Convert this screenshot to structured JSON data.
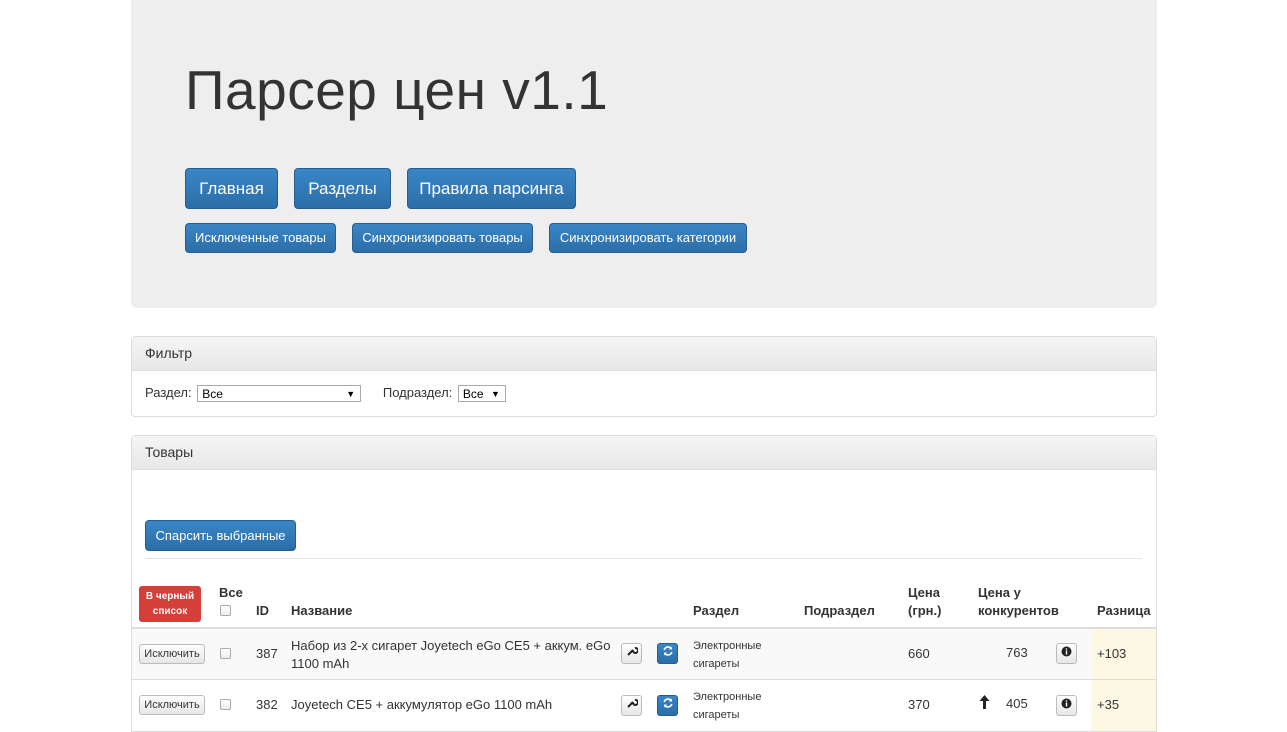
{
  "title": "Парсер цен v1.1",
  "nav": {
    "main": "Главная",
    "sections": "Разделы",
    "rules": "Правила парсинга"
  },
  "actions": {
    "excluded": "Исключенные товары",
    "sync_products": "Синхронизировать товары",
    "sync_categories": "Синхронизировать категории"
  },
  "filter": {
    "heading": "Фильтр",
    "section_label": "Раздел:",
    "section_value": "Все",
    "subsection_label": "Подраздел:",
    "subsection_value": "Все"
  },
  "products": {
    "heading": "Товары",
    "parse_selected": "Спарсить выбранные",
    "blacklist_line1": "В черный",
    "blacklist_line2": "список",
    "columns": {
      "all": "Все",
      "id": "ID",
      "name": "Название",
      "section": "Раздел",
      "subsection": "Подраздел",
      "price_line1": "Цена",
      "price_line2": "(грн.)",
      "competitor_line1": "Цена у",
      "competitor_line2": "конкурентов",
      "diff": "Разница"
    },
    "exclude_label": "Исключить",
    "rows": [
      {
        "id": "387",
        "name_line1": "Набор из 2-х сигарет Joyetech eGo CE5 + аккум. eGo",
        "name_line2": "1100 mAh",
        "section_line1": "Электронные",
        "section_line2": "сигареты",
        "subsection": "",
        "price": "660",
        "competitor_price": "763",
        "diff": "+103"
      },
      {
        "id": "382",
        "name_line1": "Joyetech CE5 + аккумулятор eGo 1100 mAh",
        "name_line2": "",
        "section_line1": "Электронные",
        "section_line2": "сигареты",
        "subsection": "",
        "price": "370",
        "competitor_price": "405",
        "diff": "+35"
      }
    ]
  },
  "colors": {
    "primary": "#337ab7",
    "danger": "#d9534f",
    "diff_bg": "#fcf8e3",
    "jumbotron": "#eeeeee"
  },
  "icons": [
    "wrench-icon",
    "refresh-icon",
    "info-icon",
    "arrow-up-icon"
  ]
}
